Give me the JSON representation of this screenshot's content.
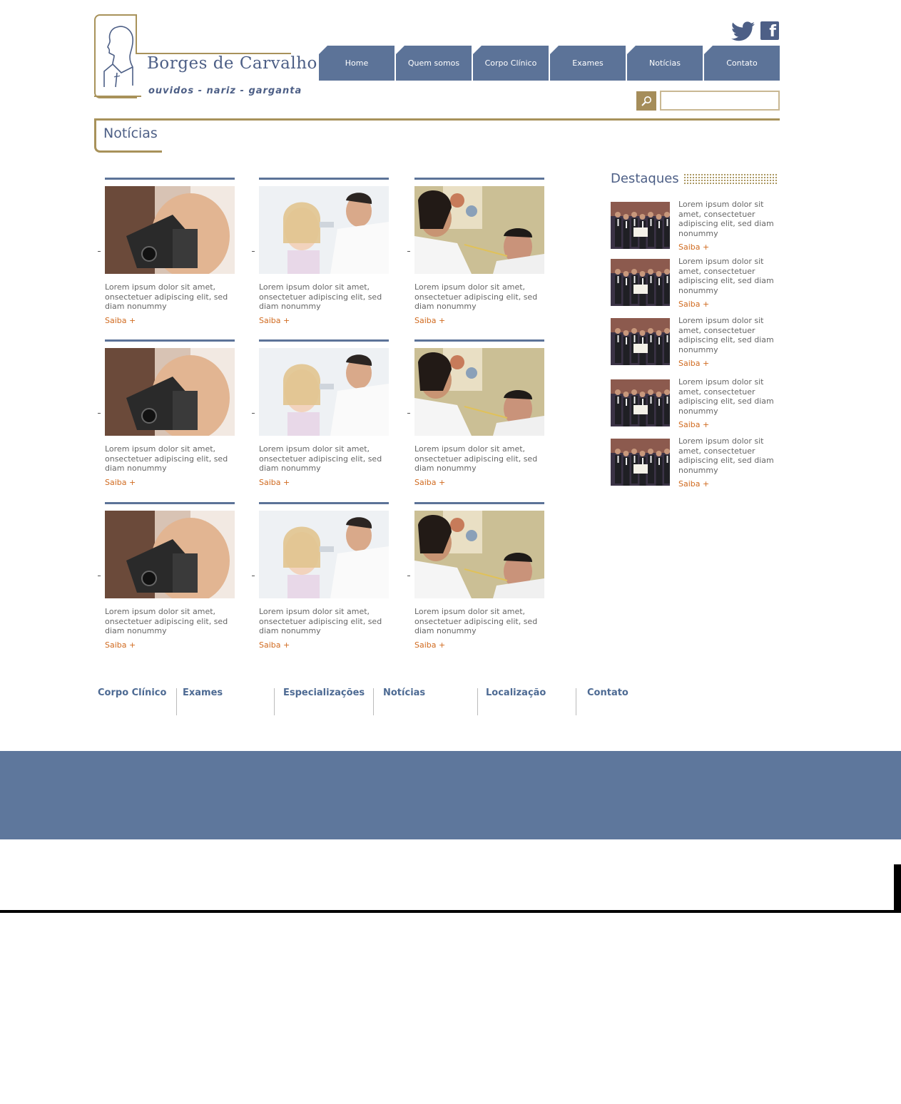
{
  "brand": {
    "name": "Borges de Carvalho",
    "tagline": "ouvidos - nariz - garganta"
  },
  "social": {
    "twitter_icon": "twitter-bird",
    "facebook_icon": "f"
  },
  "nav": [
    "Home",
    "Quem somos",
    "Corpo Clínico",
    "Exames",
    "Notícias",
    "Contato"
  ],
  "search": {
    "value": "",
    "placeholder": ""
  },
  "page_title": "Notícias",
  "news": [
    {
      "img": "otoscope",
      "text": "Lorem ipsum dolor sit amet, onsectetuer adipiscing elit, sed diam nonummy",
      "more": "Saiba +"
    },
    {
      "img": "ear-exam",
      "text": "Lorem ipsum dolor sit amet, onsectetuer adipiscing elit, sed diam nonummy",
      "more": "Saiba +"
    },
    {
      "img": "throat-exam",
      "text": "Lorem ipsum dolor sit amet, onsectetuer adipiscing elit, sed diam nonummy",
      "more": "Saiba +"
    },
    {
      "img": "otoscope",
      "text": "Lorem ipsum dolor sit amet, onsectetuer adipiscing elit, sed diam nonummy",
      "more": "Saiba +"
    },
    {
      "img": "ear-exam",
      "text": "Lorem ipsum dolor sit amet, onsectetuer adipiscing elit, sed diam nonummy",
      "more": "Saiba +"
    },
    {
      "img": "throat-exam",
      "text": "Lorem ipsum dolor sit amet, onsectetuer adipiscing elit, sed diam nonummy",
      "more": "Saiba +"
    },
    {
      "img": "otoscope",
      "text": "Lorem ipsum dolor sit amet, onsectetuer adipiscing elit, sed diam nonummy",
      "more": "Saiba +"
    },
    {
      "img": "ear-exam",
      "text": "Lorem ipsum dolor sit amet, onsectetuer adipiscing elit, sed diam nonummy",
      "more": "Saiba +"
    },
    {
      "img": "throat-exam",
      "text": "Lorem ipsum dolor sit amet, onsectetuer adipiscing elit, sed diam nonummy",
      "more": "Saiba +"
    }
  ],
  "destaques": {
    "title": "Destaques",
    "items": [
      {
        "text": "Lorem ipsum dolor sit amet, consectetuer adipiscing elit, sed diam nonummy",
        "more": "Saiba +"
      },
      {
        "text": "Lorem ipsum dolor sit amet, consectetuer adipiscing elit, sed diam nonummy",
        "more": "Saiba +"
      },
      {
        "text": "Lorem ipsum dolor sit amet, consectetuer adipiscing elit, sed diam nonummy",
        "more": "Saiba +"
      },
      {
        "text": "Lorem ipsum dolor sit amet, consectetuer adipiscing elit, sed diam nonummy",
        "more": "Saiba +"
      },
      {
        "text": "Lorem ipsum dolor sit amet, consectetuer adipiscing elit, sed diam nonummy",
        "more": "Saiba +"
      }
    ]
  },
  "footer_nav": [
    "Corpo Clínico",
    "Exames",
    "Especializações",
    "Notícias",
    "Localização",
    "Contato"
  ],
  "colors": {
    "nav_blue": "#5c7398",
    "gold": "#a8925a",
    "link_orange": "#d06a1f",
    "footer_band": "#5e779c"
  }
}
